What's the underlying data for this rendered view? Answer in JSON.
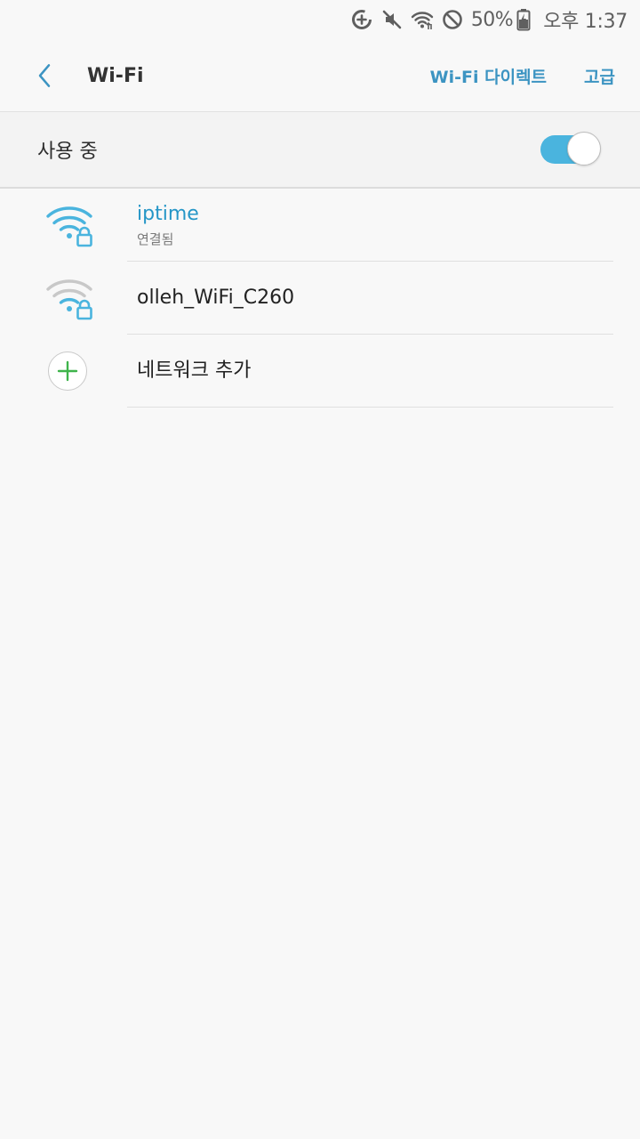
{
  "status_bar": {
    "battery_percent": "50%",
    "time": "오후 1:37",
    "icons": [
      "data-saver-icon",
      "mute-icon",
      "wifi-icon",
      "blocked-icon",
      "battery-charging-icon"
    ]
  },
  "header": {
    "title": "Wi-Fi",
    "actions": {
      "wifi_direct": "Wi-Fi 다이렉트",
      "advanced": "고급"
    }
  },
  "master_switch": {
    "label": "사용 중",
    "enabled": true
  },
  "networks": [
    {
      "name": "iptime",
      "status": "연결됨",
      "connected": true,
      "secured": true,
      "icon": "wifi-lock-icon"
    },
    {
      "name": "olleh_WiFi_C260",
      "status": "",
      "connected": false,
      "secured": true,
      "icon": "wifi-lock-icon"
    }
  ],
  "add_network": {
    "label": "네트워크 추가",
    "icon": "plus-icon"
  },
  "colors": {
    "accent": "#3c94c2",
    "connected_text": "#2596c7",
    "toggle_on": "#4ab4de",
    "wifi_active": "#4ab4de",
    "wifi_inactive": "#c8c8c8",
    "add_plus": "#3fb44b",
    "background": "#f8f8f8"
  }
}
